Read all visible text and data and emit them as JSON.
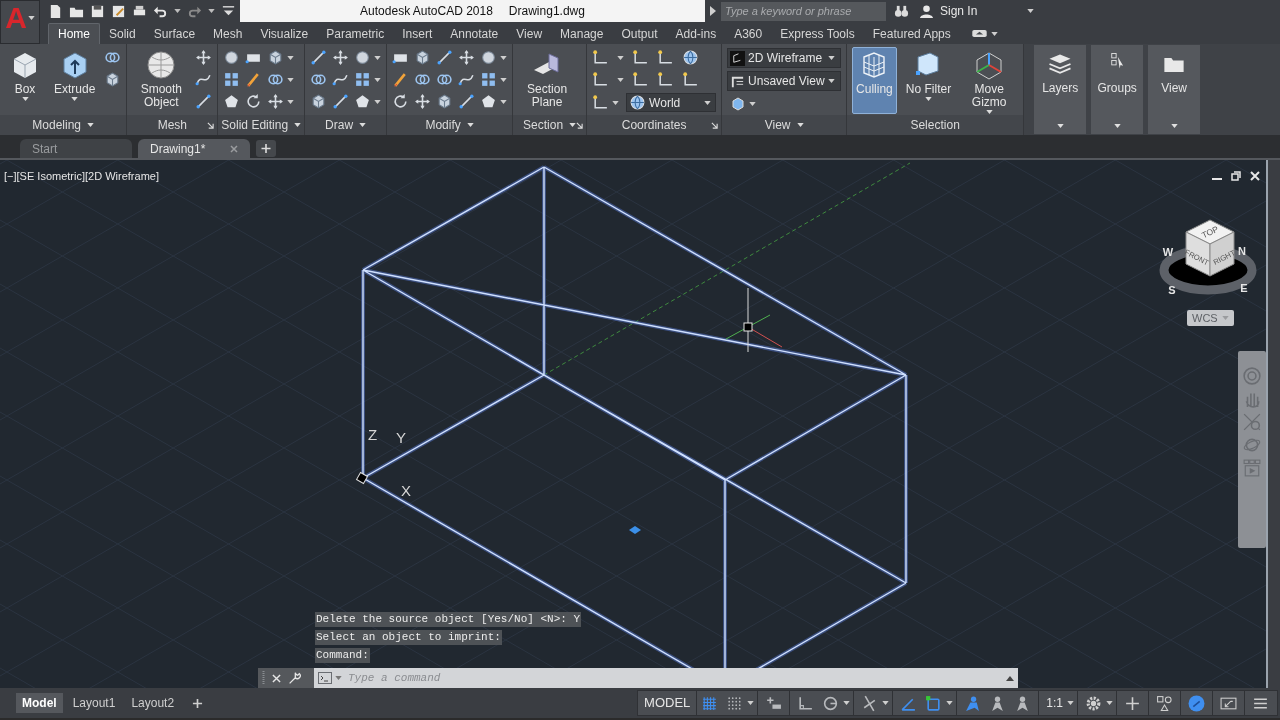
{
  "app_button": {
    "letter": "A"
  },
  "title": {
    "product": "Autodesk AutoCAD 2018",
    "file": "Drawing1.dwg"
  },
  "search": {
    "placeholder": "Type a keyword or phrase"
  },
  "account": {
    "label": "Sign In"
  },
  "ribbon_tabs": [
    {
      "label": "Home",
      "selected": true
    },
    {
      "label": "Solid",
      "selected": false
    },
    {
      "label": "Surface",
      "selected": false
    },
    {
      "label": "Mesh",
      "selected": false
    },
    {
      "label": "Visualize",
      "selected": false
    },
    {
      "label": "Parametric",
      "selected": false
    },
    {
      "label": "Insert",
      "selected": false
    },
    {
      "label": "Annotate",
      "selected": false
    },
    {
      "label": "View",
      "selected": false
    },
    {
      "label": "Manage",
      "selected": false
    },
    {
      "label": "Output",
      "selected": false
    },
    {
      "label": "Add-ins",
      "selected": false
    },
    {
      "label": "A360",
      "selected": false
    },
    {
      "label": "Express Tools",
      "selected": false
    },
    {
      "label": "Featured Apps",
      "selected": false
    }
  ],
  "ribbon_panels": [
    {
      "kind": "expanded",
      "title": "Modeling",
      "menu": true,
      "launcher": false,
      "items": [
        {
          "kind": "large",
          "label": "Box",
          "dropdown": true,
          "selected": false
        },
        {
          "kind": "large",
          "label": "Extrude",
          "dropdown": true,
          "selected": false
        },
        {
          "kind": "small_pair"
        }
      ]
    },
    {
      "kind": "expanded",
      "title": "Mesh",
      "menu": false,
      "launcher": true,
      "items": [
        {
          "kind": "large",
          "label": "Smooth Object",
          "dropdown": false,
          "selected": false
        },
        {
          "kind": "small_column",
          "dropdowns": false
        }
      ]
    },
    {
      "kind": "expanded",
      "title": "Solid Editing",
      "menu": true,
      "launcher": false,
      "items": [
        {
          "kind": "small_column",
          "dropdowns": false
        },
        {
          "kind": "small_column",
          "dropdowns": false
        },
        {
          "kind": "small_column",
          "dropdowns": true
        }
      ]
    },
    {
      "kind": "expanded",
      "title": "Draw",
      "menu": true,
      "launcher": false,
      "items": [
        {
          "kind": "small_column",
          "dropdowns": false
        },
        {
          "kind": "small_column",
          "dropdowns": false
        },
        {
          "kind": "small_column",
          "dropdowns": true
        }
      ]
    },
    {
      "kind": "expanded",
      "title": "Modify",
      "menu": true,
      "launcher": false,
      "items": [
        {
          "kind": "small_column",
          "dropdowns": false
        },
        {
          "kind": "small_column",
          "dropdowns": false
        },
        {
          "kind": "small_column",
          "dropdowns": false
        },
        {
          "kind": "small_column",
          "dropdowns": false
        },
        {
          "kind": "small_column",
          "dropdowns": true
        }
      ]
    },
    {
      "kind": "expanded",
      "title": "Section",
      "menu": true,
      "launcher": true,
      "items": [
        {
          "kind": "large",
          "label": "Section Plane",
          "dropdown": false,
          "selected": false
        }
      ]
    },
    {
      "kind": "expanded",
      "title": "Coordinates",
      "menu": false,
      "launcher": true,
      "items": [
        {
          "kind": "coords",
          "combo": "World"
        }
      ]
    },
    {
      "kind": "expanded",
      "title": "View",
      "menu": true,
      "launcher": false,
      "items": [
        {
          "kind": "combos",
          "combos": [
            "2D Wireframe",
            "Unsaved View"
          ]
        }
      ]
    },
    {
      "kind": "expanded",
      "title": "Selection",
      "menu": false,
      "launcher": false,
      "items": [
        {
          "kind": "large",
          "label": "Culling",
          "dropdown": false,
          "selected": true
        },
        {
          "kind": "large",
          "label": "No Filter",
          "dropdown": true,
          "selected": false
        },
        {
          "kind": "large",
          "label": "Move Gizmo",
          "dropdown": true,
          "selected": false
        }
      ]
    },
    {
      "kind": "collapsed",
      "title": "Layers"
    },
    {
      "kind": "collapsed",
      "title": "Groups"
    },
    {
      "kind": "collapsed",
      "title": "View"
    }
  ],
  "file_tabs": [
    {
      "label": "Start",
      "selected": false,
      "closable": false
    },
    {
      "label": "Drawing1*",
      "selected": true,
      "closable": true
    }
  ],
  "viewport": {
    "controls": [
      "[−]",
      "[SE Isometric]",
      "[2D Wireframe]"
    ],
    "ucs_labels": [
      "Z",
      "Y",
      "X"
    ],
    "viewcube": {
      "faces": [
        "TOP",
        "FRONT",
        "RIGHT"
      ],
      "compass": [
        "W",
        "N",
        "S",
        "E"
      ]
    },
    "coordinate_system": "WCS"
  },
  "command_history": [
    "Delete the source object [Yes/No] <N>: Y",
    "Select an object to imprint:",
    "Command:"
  ],
  "command_line": {
    "placeholder": "Type a command"
  },
  "layout_tabs": [
    {
      "label": "Model",
      "selected": true
    },
    {
      "label": "Layout1",
      "selected": false
    },
    {
      "label": "Layout2",
      "selected": false
    }
  ],
  "status": {
    "space": "MODEL",
    "items": [
      {
        "kind": "grid",
        "on": true
      },
      {
        "kind": "snap",
        "on": false
      },
      {
        "kind": "infer",
        "on": false
      },
      {
        "kind": "ortho",
        "on": false
      },
      {
        "kind": "polar",
        "on": false
      },
      {
        "kind": "isodraft",
        "on": false
      },
      {
        "kind": "dynucs",
        "on": true
      },
      {
        "kind": "selcycle",
        "on": true
      },
      {
        "kind": "annovis",
        "on": true
      },
      {
        "kind": "autoscale",
        "on": false
      },
      {
        "kind": "annoscale",
        "on": false
      },
      {
        "kind": "scale",
        "label": "1:1"
      },
      {
        "kind": "gear"
      },
      {
        "kind": "plus"
      },
      {
        "kind": "isolate"
      },
      {
        "kind": "hwaccel",
        "on": true
      },
      {
        "kind": "fullscreen"
      },
      {
        "kind": "menu"
      }
    ]
  }
}
